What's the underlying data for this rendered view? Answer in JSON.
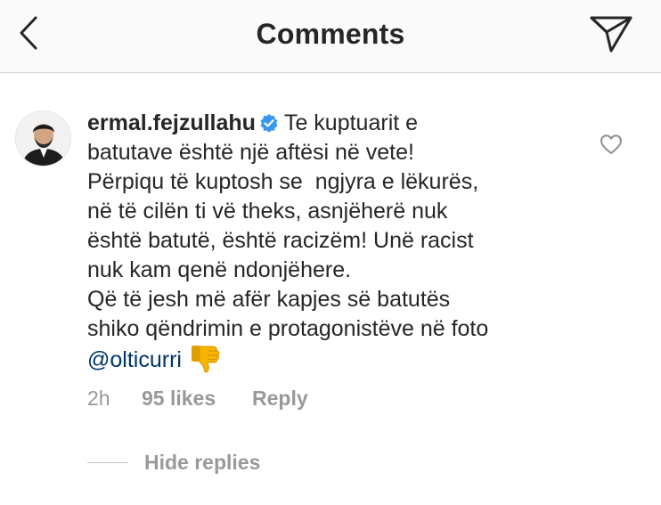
{
  "header": {
    "title": "Comments",
    "back_icon": "chevron-left-icon",
    "send_icon": "paper-plane-icon"
  },
  "comment": {
    "username": "ermal.fejzullahu",
    "verified": true,
    "lines": [
      "Te kuptuarit e",
      "batutave është një aftësi në vete!",
      "Përpiqu të kuptosh se  ngjyra e lëkurës,",
      "në të cilën ti vë theks, asnjëherë nuk",
      "është batutë, është racizëm! Unë racist",
      "nuk kam qenë ndonjëhere.",
      "Që të jesh më afër kapjes së batutës",
      "shiko qëndrimin e protagonistëve në foto"
    ],
    "mention": "@olticurri",
    "emoji": "thumbs-down-emoji",
    "time": "2h",
    "likes": "95 likes",
    "reply_label": "Reply"
  },
  "replies": {
    "hide_label": "Hide replies"
  },
  "colors": {
    "header_bg": "#fafafa",
    "text": "#262626",
    "muted": "#999999",
    "mention": "#003569",
    "verified": "#3897f0",
    "emoji": "#f7b500"
  }
}
